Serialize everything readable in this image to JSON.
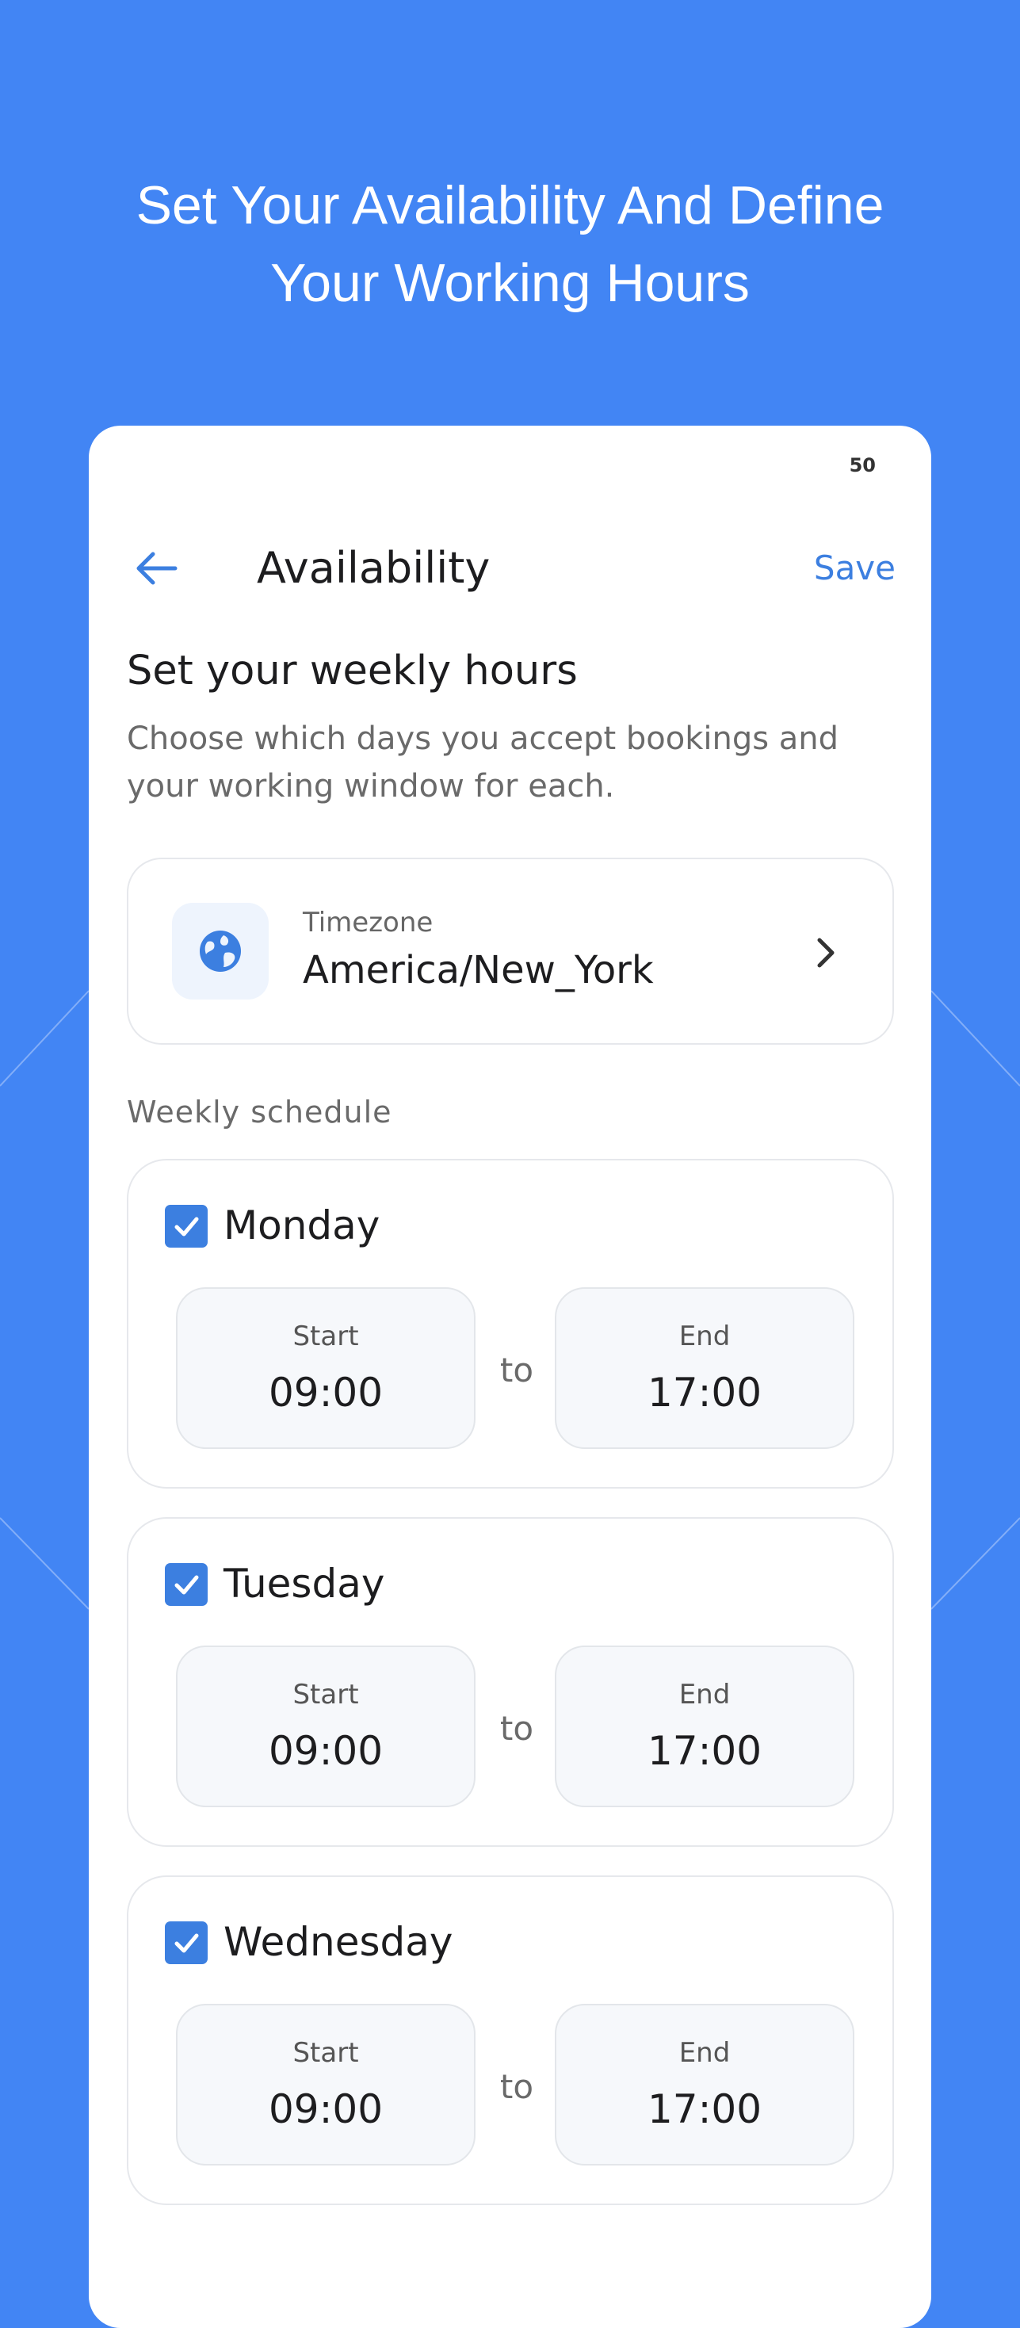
{
  "headline": {
    "line1": "Set Your Availability And Define",
    "line2": "Your Working Hours"
  },
  "status_bar": {
    "battery": "50"
  },
  "header": {
    "title": "Availability",
    "save_label": "Save",
    "back_icon": "arrow-left-icon"
  },
  "intro": {
    "heading": "Set your weekly hours",
    "subtitle": "Choose which days you accept bookings and your working window for each."
  },
  "timezone": {
    "label": "Timezone",
    "value": "America/New_York",
    "icon": "globe-icon",
    "chevron_icon": "chevron-right-icon"
  },
  "schedule": {
    "label": "Weekly schedule",
    "days": [
      {
        "name": "Monday",
        "checked": true,
        "start_label": "Start",
        "start": "09:00",
        "to": "to",
        "end_label": "End",
        "end": "17:00"
      },
      {
        "name": "Tuesday",
        "checked": true,
        "start_label": "Start",
        "start": "09:00",
        "to": "to",
        "end_label": "End",
        "end": "17:00"
      },
      {
        "name": "Wednesday",
        "checked": true,
        "start_label": "Start",
        "start": "09:00",
        "to": "to",
        "end_label": "End",
        "end": "17:00"
      }
    ]
  },
  "colors": {
    "background": "#4285F4",
    "accent": "#3c7fe0",
    "card_border": "#e6e8ec",
    "time_box_bg": "#f6f8fb"
  }
}
